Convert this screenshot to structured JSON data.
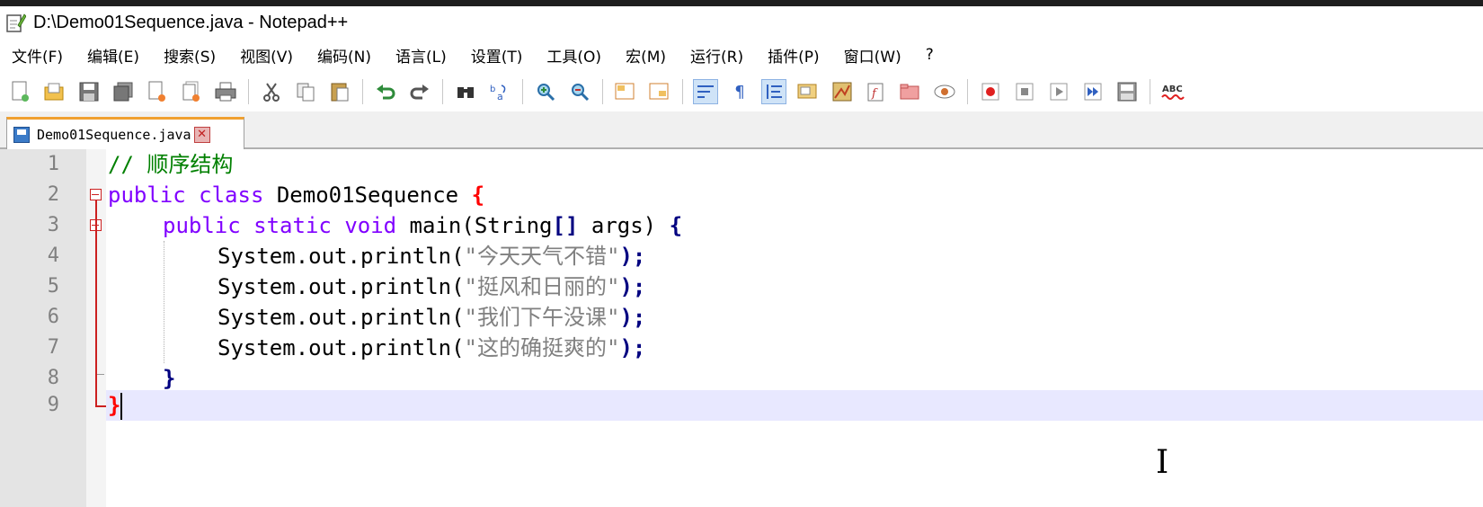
{
  "window": {
    "title": "D:\\Demo01Sequence.java - Notepad++",
    "app_icon": "notepad-plus-plus-icon"
  },
  "menu": {
    "items": [
      "文件(F)",
      "编辑(E)",
      "搜索(S)",
      "视图(V)",
      "编码(N)",
      "语言(L)",
      "设置(T)",
      "工具(O)",
      "宏(M)",
      "运行(R)",
      "插件(P)",
      "窗口(W)",
      "?"
    ]
  },
  "toolbar": {
    "buttons": [
      "new-file-icon",
      "open-file-icon",
      "save-icon",
      "save-all-icon",
      "close-icon",
      "close-all-icon",
      "print-icon",
      "cut-icon",
      "copy-icon",
      "paste-icon",
      "undo-icon",
      "redo-icon",
      "find-icon",
      "replace-icon",
      "zoom-in-icon",
      "zoom-out-icon",
      "sync-vertical-icon",
      "sync-horizontal-icon",
      "word-wrap-icon",
      "show-all-chars-icon",
      "indent-guide-icon",
      "user-lang-icon",
      "doc-map-icon",
      "function-list-icon",
      "folder-as-workspace-icon",
      "monitoring-icon",
      "record-macro-icon",
      "stop-record-icon",
      "play-macro-icon",
      "run-macro-multiple-icon",
      "save-macro-icon",
      "spell-check-icon"
    ],
    "spell_label": "ABC"
  },
  "tab": {
    "label": "Demo01Sequence.java"
  },
  "editor": {
    "line_numbers": [
      "1",
      "2",
      "3",
      "4",
      "5",
      "6",
      "7",
      "8",
      "9"
    ],
    "comment": "// 顺序结构",
    "l2_kw": "public class",
    "l2_name": " Demo01Sequence ",
    "l2_brace": "{",
    "l3_kw1": "public",
    "l3_kw2": "static",
    "l3_kw3": "void",
    "l3_main": " main(",
    "l3_type": "String",
    "l3_arr": "[]",
    "l3_args": " args) ",
    "l3_brace": "{",
    "println_prefix": "System.out.println(",
    "strings": [
      "\"今天天气不错\"",
      "\"挺风和日丽的\"",
      "\"我们下午没课\"",
      "\"这的确挺爽的\""
    ],
    "println_suffix": ");",
    "l8_brace": "}",
    "l9_brace": "}"
  },
  "colors": {
    "keyword": "#8000ff",
    "comment": "#008000",
    "string": "#808080",
    "operator": "#000080",
    "brace_match": "#ff0000",
    "current_line": "#e8e8ff"
  }
}
